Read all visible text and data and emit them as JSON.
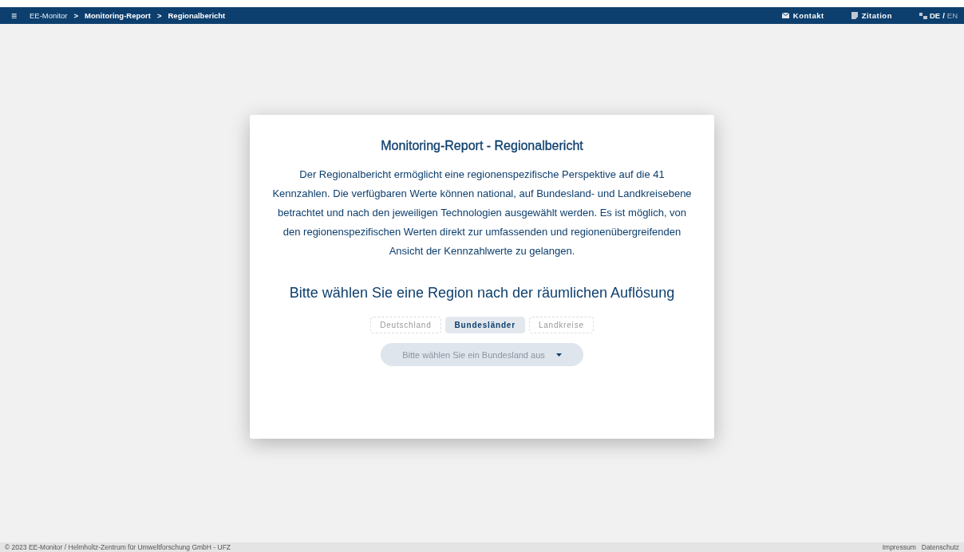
{
  "topbar": {
    "menu_icon": "≡",
    "breadcrumbs": [
      {
        "label": "EE-Monitor",
        "current": false
      },
      {
        "label": "Monitoring-Report",
        "current": true
      },
      {
        "label": "Regionalbericht",
        "current": true
      }
    ],
    "separator": ">",
    "links": [
      {
        "label": "Kontakt",
        "kind": "mail"
      },
      {
        "label": "Zitation",
        "kind": "quote"
      }
    ],
    "languages": [
      {
        "label": "DE",
        "selected": true
      },
      {
        "label": "EN",
        "selected": false
      }
    ],
    "language_separator": "/"
  },
  "card": {
    "title": "Monitoring-Report - Regionalbericht",
    "description": "Der Regionalbericht ermöglicht eine regionenspezifische Perspektive auf die 41 Kennzahlen. Die verfügbaren Werte können national, auf Bundesland- und Landkreisebene betrachtet und nach den jeweiligen Technologien ausgewählt werden. Es ist möglich, von den regionenspezifischen Werten direkt zur umfassenden und regionenübergreifenden Ansicht der Kennzahlwerte zu gelangen.",
    "prompt": "Bitte wählen Sie eine Region nach der räumlichen Auflösung",
    "resolutions": [
      {
        "label": "Deutschland",
        "selected": false
      },
      {
        "label": "Bundesländer",
        "selected": true
      },
      {
        "label": "Landkreise",
        "selected": false
      }
    ],
    "dropdown": {
      "placeholder": "Bitte wählen Sie ein Bundesland aus"
    }
  },
  "footer": {
    "copyright": "© 2023 EE-Monitor / Helmholtz-Zentrum für Umweltforschung GmbH - UFZ",
    "links": [
      "Impressum",
      "Datenschutz"
    ]
  }
}
